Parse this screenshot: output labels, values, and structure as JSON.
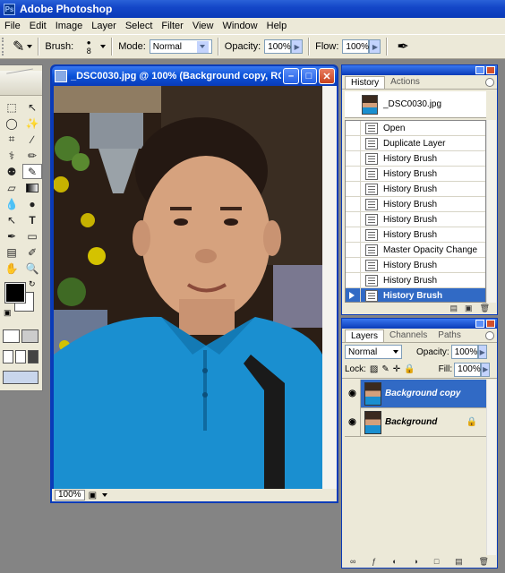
{
  "app": {
    "title": "Adobe Photoshop"
  },
  "menu": [
    "File",
    "Edit",
    "Image",
    "Layer",
    "Select",
    "Filter",
    "View",
    "Window",
    "Help"
  ],
  "options": {
    "brush_label": "Brush:",
    "brush_size": "8",
    "mode_label": "Mode:",
    "mode_value": "Normal",
    "opacity_label": "Opacity:",
    "opacity_value": "100%",
    "flow_label": "Flow:",
    "flow_value": "100%"
  },
  "document": {
    "title": "_DSC0030.jpg @ 100% (Background copy, RG...",
    "zoom": "100%"
  },
  "history": {
    "tabs": [
      "History",
      "Actions"
    ],
    "snapshot": "_DSC0030.jpg",
    "items": [
      "Open",
      "Duplicate Layer",
      "History Brush",
      "History Brush",
      "History Brush",
      "History Brush",
      "History Brush",
      "History Brush",
      "Master Opacity Change",
      "History Brush",
      "History Brush",
      "History Brush"
    ],
    "selected_index": 11
  },
  "layers": {
    "tabs": [
      "Layers",
      "Channels",
      "Paths"
    ],
    "blend_mode": "Normal",
    "opacity_label": "Opacity:",
    "opacity_value": "100%",
    "lock_label": "Lock:",
    "fill_label": "Fill:",
    "fill_value": "100%",
    "items": [
      {
        "name": "Background copy",
        "selected": true
      },
      {
        "name": "Background",
        "selected": false
      }
    ]
  },
  "colors": {
    "titlebar": "#0a3bb8",
    "selection": "#316ac5",
    "panel": "#ece9d8",
    "shirt": "#1a8fd0"
  },
  "icons": [
    "history-brush-icon",
    "marquee-icon",
    "lasso-icon",
    "crop-icon",
    "brush-icon",
    "clone-stamp-icon",
    "eraser-icon",
    "gradient-icon",
    "dodge-icon",
    "path-select-icon",
    "type-icon",
    "pen-icon",
    "shape-icon",
    "notes-icon",
    "eyedropper-icon",
    "hand-icon",
    "zoom-icon",
    "eye-icon",
    "lock-icon"
  ]
}
